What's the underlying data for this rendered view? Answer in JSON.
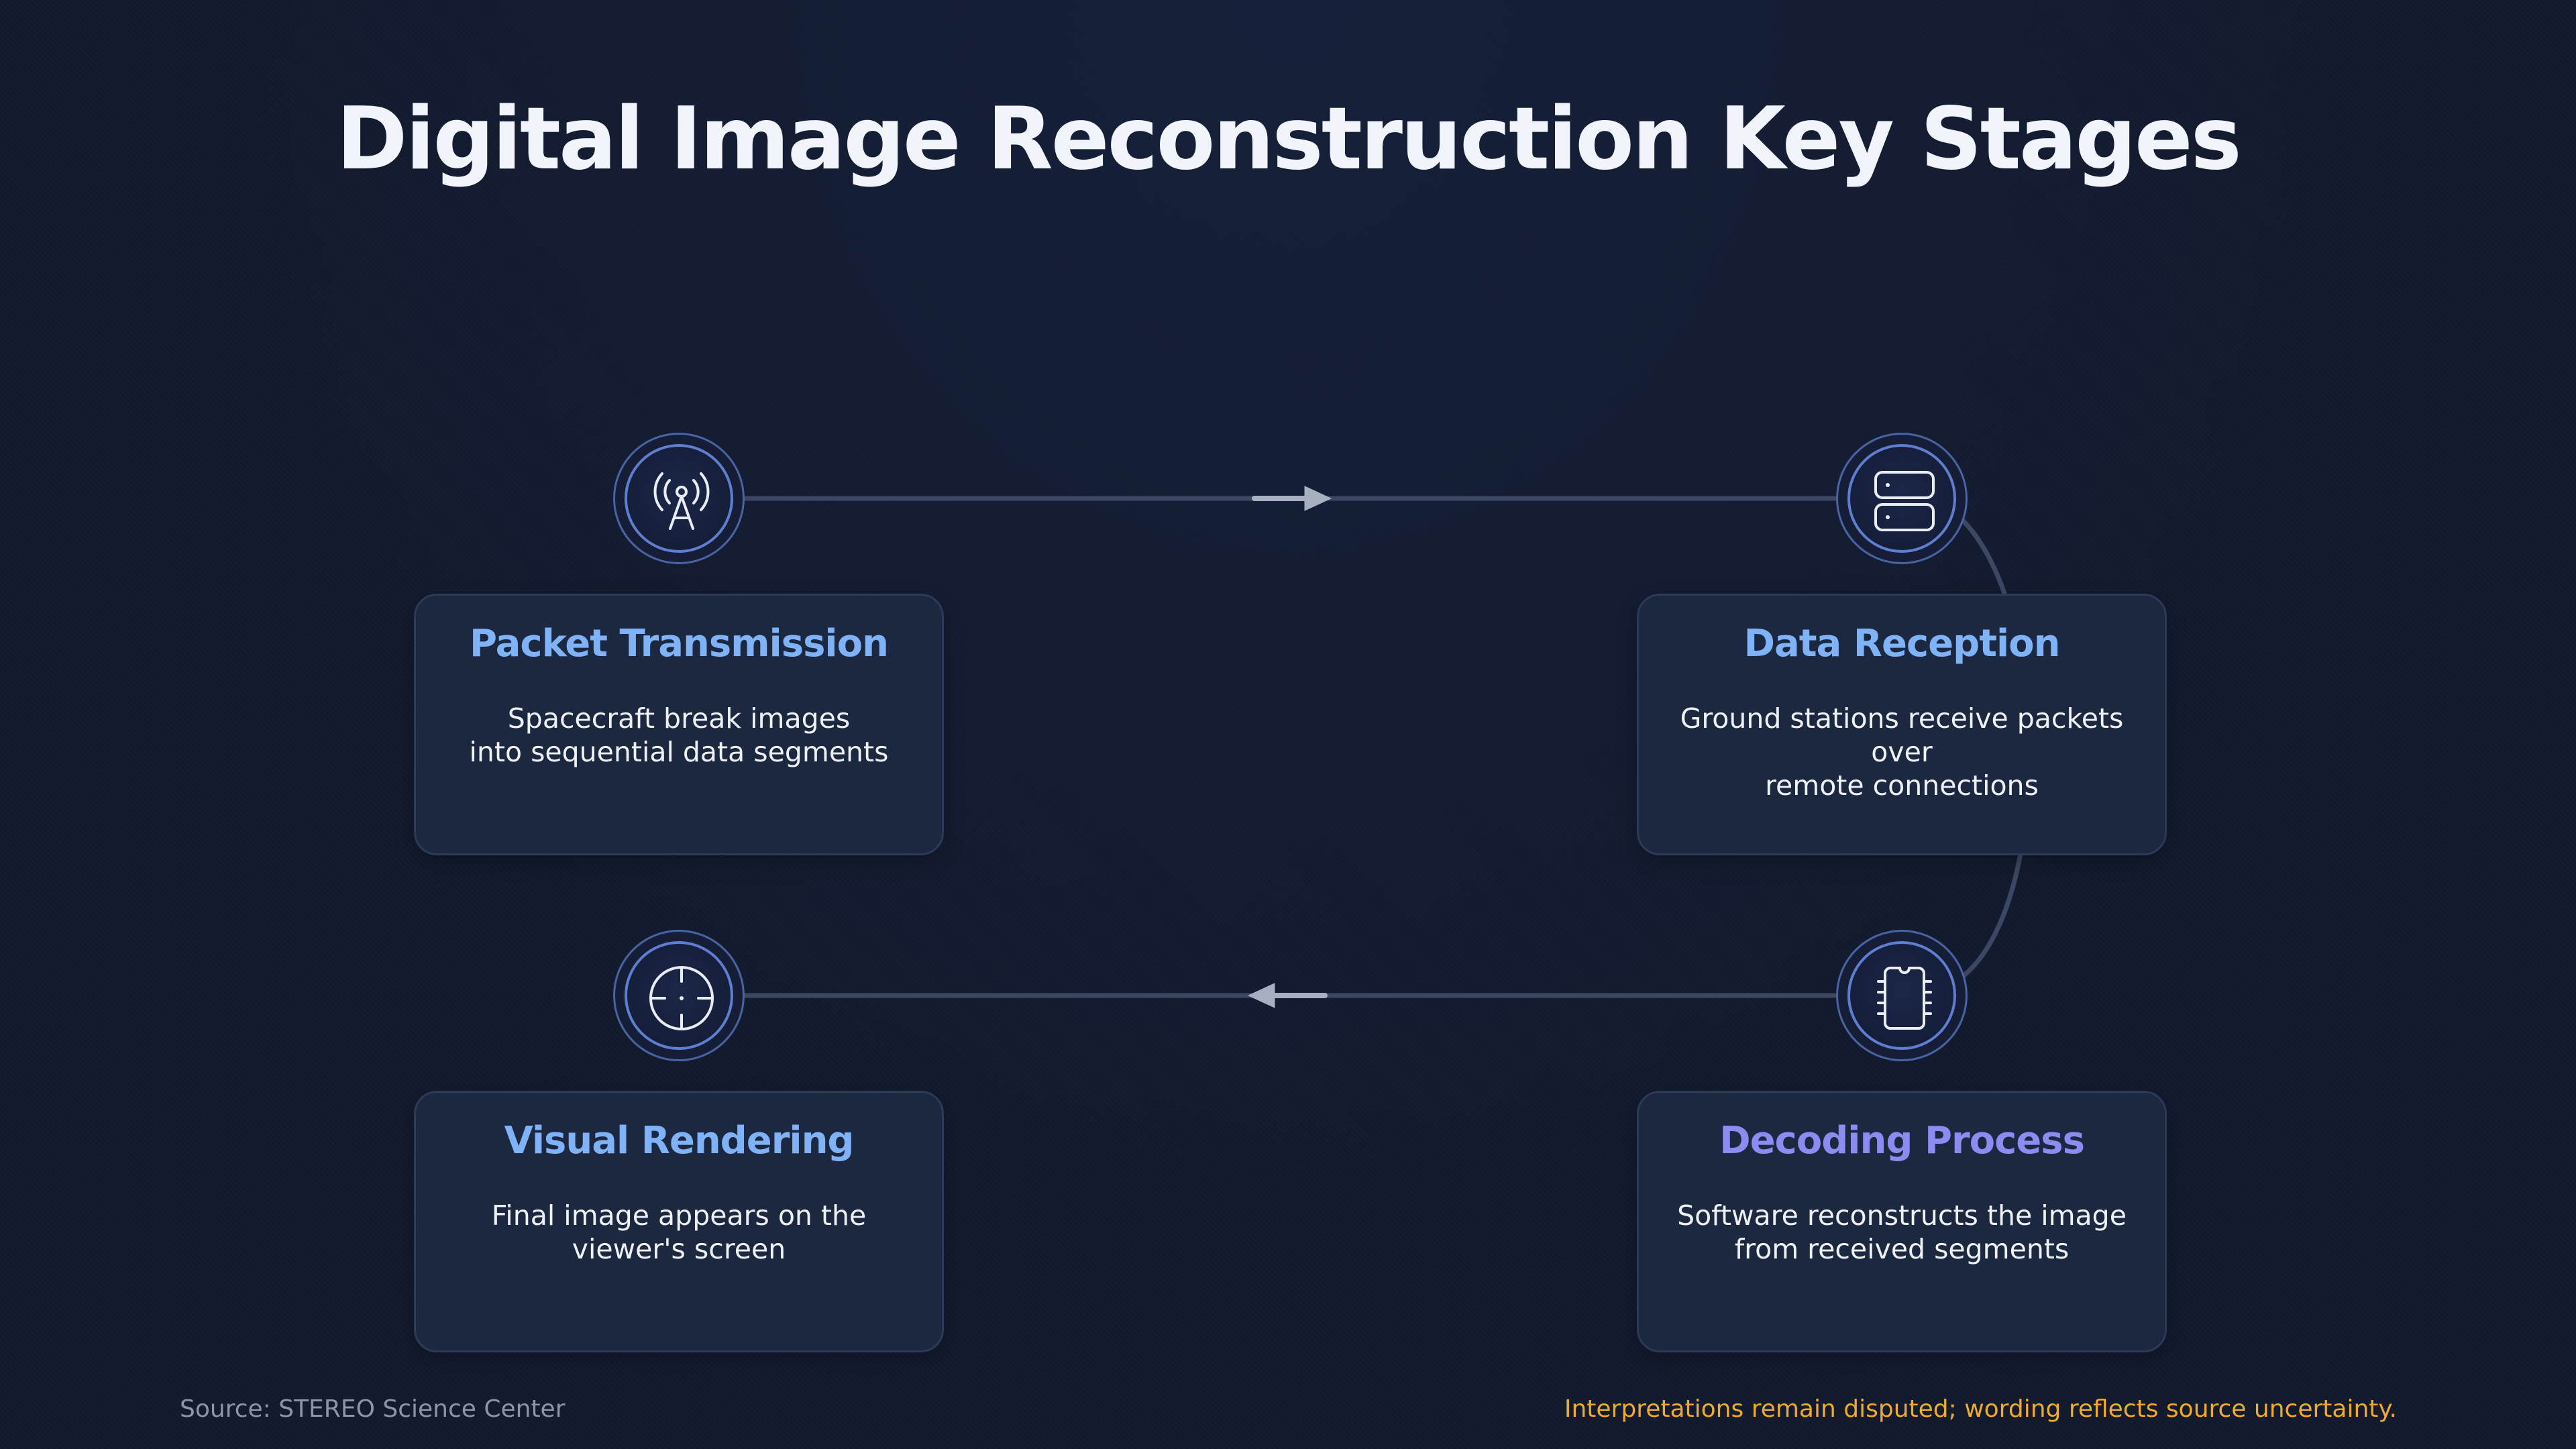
{
  "title": "Digital Image Reconstruction Key Stages",
  "colors": {
    "heading_blue": "#7fb2f6",
    "heading_indigo": "#8b8cf2",
    "connector": "#3c4863",
    "arrow": "#a7b0c0",
    "note": "#f0ab2e"
  },
  "stages": [
    {
      "heading": "Packet Transmission",
      "description": "Spacecraft break images\ninto sequential data segments",
      "icon": "antenna-tower-icon"
    },
    {
      "heading": "Data Reception",
      "description": "Ground stations receive packets over\nremote connections",
      "icon": "server-icon"
    },
    {
      "heading": "Decoding Process",
      "description": "Software reconstructs the image\nfrom received segments",
      "icon": "chip-icon"
    },
    {
      "heading": "Visual Rendering",
      "description": "Final image appears on the\nviewer's screen",
      "icon": "crosshair-icon"
    }
  ],
  "footer": {
    "source": "Source: STEREO Science Center",
    "note": "Interpretations remain disputed; wording reflects source uncertainty."
  }
}
